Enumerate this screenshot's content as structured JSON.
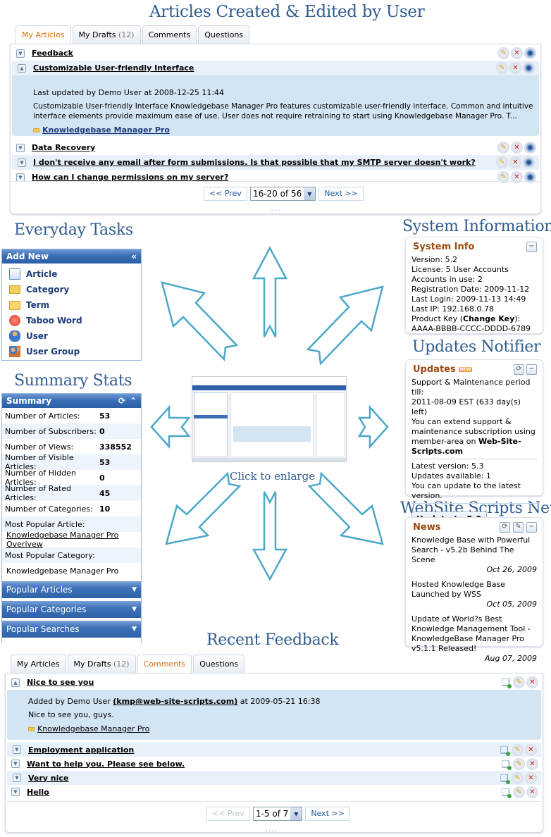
{
  "sections": {
    "articles_heading": "Articles Created & Edited by User",
    "everyday_heading": "Everyday Tasks",
    "sysinfo_heading": "System Information",
    "updates_heading": "Updates Notifier",
    "summary_heading": "Summary Stats",
    "news_heading": "WebSite Scripts News",
    "feedback_heading": "Recent Feedback"
  },
  "articles_panel": {
    "tabs": [
      {
        "label": "My Articles",
        "count": ""
      },
      {
        "label": "My Drafts",
        "count": "(12)"
      },
      {
        "label": "Comments",
        "count": ""
      },
      {
        "label": "Questions",
        "count": ""
      }
    ],
    "active_tab": "My Articles",
    "rows": [
      {
        "title": "Feedback",
        "toggle": "expand"
      },
      {
        "title": "Customizable User-friendly Interface",
        "toggle": "collapse"
      },
      {
        "title": "Data Recovery",
        "toggle": "expand"
      },
      {
        "title": "I don't receive any email after form submissions. Is that possible that my SMTP server doesn't work?",
        "toggle": "expand"
      },
      {
        "title": "How can I change permissions on my server?",
        "toggle": "expand"
      }
    ],
    "expanded": {
      "meta": "Last updated by Demo User at 2008-12-25 11:44",
      "body": "Customizable User-friendly Interface Knowledgebase Manager Pro features customizable user-friendly interface. Common and intuitive interface elements provide maximum ease of use. User does not require retraining to start using Knowledgebase Manager Pro. T...",
      "category": "Knowledgebase Manager Pro"
    },
    "actions": [
      "edit-icon",
      "delete-icon",
      "view-icon"
    ],
    "pager": {
      "prev": "<< Prev",
      "select": "16-20 of 56",
      "next": "Next >>"
    },
    "more": "...."
  },
  "add_new": {
    "title": "Add New",
    "collapse_glyph": "«",
    "items": [
      "Article",
      "Category",
      "Term",
      "Taboo Word",
      "User",
      "User Group"
    ]
  },
  "summary": {
    "title": "Summary",
    "stats": [
      {
        "label": "Number of Articles:",
        "value": "53"
      },
      {
        "label": "Number of Subscribers:",
        "value": "0"
      },
      {
        "label": "Number of Views:",
        "value": "338552"
      },
      {
        "label": "Number of Visible Articles:",
        "value": "53"
      },
      {
        "label": "Number of Hidden Articles:",
        "value": "0"
      },
      {
        "label": "Number of Rated Articles:",
        "value": "45"
      },
      {
        "label": "Number of Categories:",
        "value": "10"
      }
    ],
    "popular_article_label": "Most Popular Article:",
    "popular_article": "Knowledgebase Manager Pro Overivew",
    "popular_category_label": "Most Popular Category:",
    "popular_category": "Knowledgebase Manager Pro",
    "collapsed_panels": [
      "Popular Articles",
      "Popular Categories",
      "Popular Searches"
    ]
  },
  "center": {
    "caption": "Click to enlarge",
    "thumbnail_alt": "Knowledgebase Manager screenshot"
  },
  "system_info": {
    "title": "System Info",
    "version": "Version: 5.2",
    "license": "License: 5 User Accounts",
    "accounts": "Accounts in use: 2",
    "registration": "Registration Date: 2009-11-12",
    "last_login": "Last Login: 2009-11-13 14:49",
    "last_ip": "Last IP: 192.168.0.78",
    "product_key_label": "Product Key (",
    "change_key": "Change Key",
    "product_key_close": "):",
    "product_key": "AAAA-BBBB-CCCC-DDDD-6789"
  },
  "updates": {
    "title": "Updates",
    "badge": "NEW",
    "support_line1": "Support & Maintenance period till:",
    "support_line2": "2011-08-09 EST (633 day(s) left)",
    "extend_text": "You can extend support & maintenance subscription using member-area on ",
    "extend_link": "Web-Site-Scripts.com",
    "latest": "Latest version: 5.3",
    "available": "Updates available: 1",
    "can_update": "You can update to the latest version.",
    "button": "Update to 5.3"
  },
  "news": {
    "title": "News",
    "items": [
      {
        "title": "Knowledge Base with Powerful Search - v5.2b Behind The Scene",
        "date": "Oct 26, 2009"
      },
      {
        "title": "Hosted Knowledge Base Launched by WSS",
        "date": "Oct 05, 2009"
      },
      {
        "title": "Update of World?s Best Knowledge Management Tool - KnowledgeBase Manager Pro v5.1.1 Released!",
        "date": "Aug 07, 2009"
      }
    ]
  },
  "feedback_panel": {
    "tabs": [
      {
        "label": "My Articles",
        "count": ""
      },
      {
        "label": "My Drafts",
        "count": "(12)"
      },
      {
        "label": "Comments",
        "count": ""
      },
      {
        "label": "Questions",
        "count": ""
      }
    ],
    "active_tab": "Comments",
    "rows": [
      {
        "title": "Nice to see you",
        "toggle": "collapse"
      },
      {
        "title": "Employment application",
        "toggle": "expand"
      },
      {
        "title": "Want to help you. Please see below.",
        "toggle": "expand"
      },
      {
        "title": "Very nice",
        "toggle": "expand"
      },
      {
        "title": "Hello",
        "toggle": "expand"
      }
    ],
    "expanded": {
      "meta_prefix": "Added by Demo User ",
      "email": "(kmp@web-site-scripts.com)",
      "meta_suffix": " at 2009-05-21 16:38",
      "body": "Nice to see you, guys.",
      "category": "Knowledgebase Manager Pro"
    },
    "actions": [
      "comment-add-icon",
      "edit-icon",
      "delete-icon"
    ],
    "pager": {
      "prev": "<< Prev",
      "select": "1-5 of 7",
      "next": "Next >>"
    },
    "more": "...."
  },
  "colors": {
    "heading": "#2f5c8f",
    "active_tab": "#d07010",
    "sidebar_header": "#3a6fb6",
    "widget_title": "#9b4a10",
    "expanded_bg": "#d3e4f3",
    "arrow": "#4aa8c8"
  }
}
